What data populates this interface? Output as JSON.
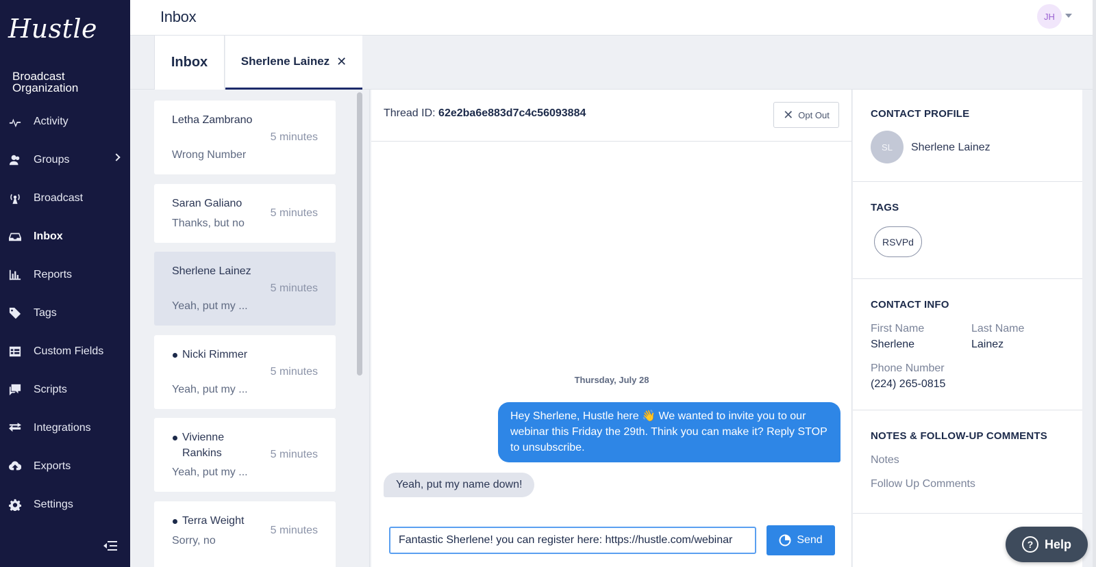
{
  "sidebar": {
    "logo": "Hustle",
    "org": "Broadcast Organization",
    "items": [
      {
        "label": "Activity",
        "icon": "activity-icon"
      },
      {
        "label": "Groups",
        "icon": "groups-icon"
      },
      {
        "label": "Broadcast",
        "icon": "broadcast-icon"
      },
      {
        "label": "Inbox",
        "icon": "inbox-icon"
      },
      {
        "label": "Reports",
        "icon": "reports-icon"
      },
      {
        "label": "Tags",
        "icon": "tag-icon"
      },
      {
        "label": "Custom Fields",
        "icon": "custom-fields-icon"
      },
      {
        "label": "Scripts",
        "icon": "scripts-icon"
      },
      {
        "label": "Integrations",
        "icon": "integrations-icon"
      },
      {
        "label": "Exports",
        "icon": "exports-icon"
      },
      {
        "label": "Settings",
        "icon": "gear-icon"
      }
    ],
    "active": "Inbox"
  },
  "header": {
    "title": "Inbox",
    "user_initials": "JH"
  },
  "tabs": {
    "inbox": "Inbox",
    "thread": "Sherlene Lainez",
    "close_glyph": "✕"
  },
  "conversations": [
    {
      "name": "Letha Zambrano",
      "preview": "Wrong Number",
      "time": "5 minutes",
      "unread": false
    },
    {
      "name": "Saran Galiano",
      "preview": "Thanks, but no",
      "time": "5 minutes",
      "unread": false
    },
    {
      "name": "Sherlene Lainez",
      "preview": "Yeah, put my ...",
      "time": "5 minutes",
      "unread": false
    },
    {
      "name": "Nicki Rimmer",
      "preview": "Yeah, put my ...",
      "time": "5 minutes",
      "unread": true
    },
    {
      "name": "Vivienne Rankins",
      "preview": "Yeah, put my ...",
      "time": "5 minutes",
      "unread": true
    },
    {
      "name": "Terra Weight",
      "preview": "Sorry, no",
      "time": "5 minutes",
      "unread": true
    }
  ],
  "thread": {
    "id_label": "Thread ID:",
    "id_value": "62e2ba6e883d7c4c56093884",
    "opt_out": "Opt Out",
    "date": "Thursday, July 28",
    "outgoing": "Hey Sherlene, Hustle here 👋 We wanted to invite you to our webinar this Friday the 29th. Think you can make it? Reply STOP to unsubscribe.",
    "incoming": "Yeah, put my name down!",
    "composer_value": "Fantastic Sherlene! you can register here: https://hustle.com/webinar",
    "send": "Send"
  },
  "contact": {
    "profile_heading": "CONTACT PROFILE",
    "initials": "SL",
    "name": "Sherlene Lainez",
    "tags_heading": "TAGS",
    "tags": [
      "RSVPd"
    ],
    "info_heading": "CONTACT INFO",
    "first_name_label": "First Name",
    "first_name": "Sherlene",
    "last_name_label": "Last Name",
    "last_name": "Lainez",
    "phone_label": "Phone Number",
    "phone": "(224) 265-0815",
    "notes_heading": "NOTES & FOLLOW-UP COMMENTS",
    "notes_label": "Notes",
    "followup_label": "Follow Up Comments"
  },
  "help": "Help",
  "colors": {
    "sidebar_bg": "#16193f",
    "accent_blue": "#2e86e6",
    "text_dark": "#1c2a4a"
  }
}
